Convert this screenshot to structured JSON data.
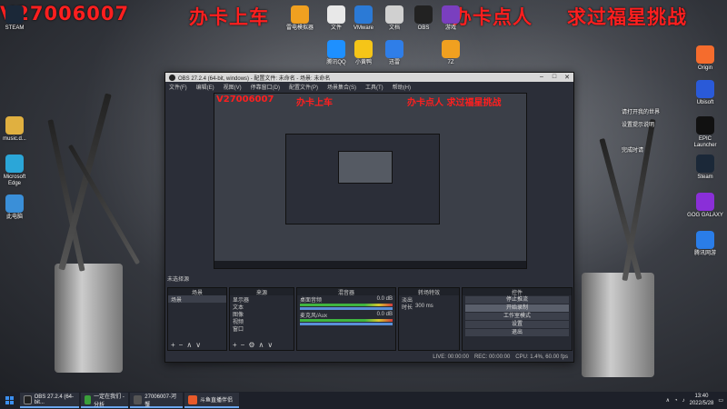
{
  "overlay": {
    "left_text": "V27006007",
    "mid_text": "办卡上车",
    "right_text_1": "办卡点人",
    "right_text_2": "求过福星挑战"
  },
  "desktop_icons_top": [
    {
      "label": "STEAM",
      "name": "steam-top-icon",
      "color": "#1b2838"
    },
    {
      "label": "雷电模拟器",
      "name": "emulator-icon",
      "color": "#f0a020"
    },
    {
      "label": "文件",
      "name": "file-icon",
      "color": "#e8e8e8"
    },
    {
      "label": "VMware",
      "name": "vmware-icon",
      "color": "#2b7ad6"
    },
    {
      "label": "文档",
      "name": "doc-icon",
      "color": "#d0d0d0"
    },
    {
      "label": "OBS",
      "name": "obs-desktop-icon",
      "color": "#222"
    },
    {
      "label": "游戏",
      "name": "game-icon",
      "color": "#7a3fbf"
    }
  ],
  "desktop_icons_row2": [
    {
      "label": "腾讯QQ",
      "name": "qq-icon",
      "color": "#1e90ff"
    },
    {
      "label": "小黄鸭",
      "name": "duck-icon",
      "color": "#f5c518"
    },
    {
      "label": "迅雷",
      "name": "thunder-icon",
      "color": "#2f7ee8"
    },
    {
      "label": "7Z",
      "name": "zip-icon",
      "color": "#f0a020"
    }
  ],
  "desktop_icons_left": [
    {
      "label": "music.d...",
      "name": "music-folder-icon",
      "color": "#e0b040"
    },
    {
      "label": "Microsoft Edge",
      "name": "edge-icon",
      "color": "#2ba6d8"
    },
    {
      "label": "此电脑",
      "name": "this-pc-icon",
      "color": "#3a8fd8"
    }
  ],
  "desktop_icons_right": [
    {
      "label": "Origin",
      "name": "origin-icon",
      "color": "#f56c2d"
    },
    {
      "label": "Ubisoft",
      "name": "ubisoft-icon",
      "color": "#2a5ad8"
    },
    {
      "label": "EPIC Launcher",
      "name": "epic-icon",
      "color": "#111"
    },
    {
      "label": "Steam",
      "name": "steam-icon",
      "color": "#1b2838"
    },
    {
      "label": "GOG GALAXY",
      "name": "gog-icon",
      "color": "#8a2fd8"
    },
    {
      "label": "腾讯网游",
      "name": "tencent-game-icon",
      "color": "#2a7de8"
    }
  ],
  "side_texts": [
    "腾讯",
    "游戏",
    "设置",
    "说明书",
    "请打开我的世界",
    "设置提示说明",
    "完成时请"
  ],
  "obs": {
    "title": "OBS 27.2.4 (64-bit, windows) - 配置文件: 未命名 - 场景: 未命名",
    "menu": [
      "文件(F)",
      "编辑(E)",
      "视图(V)",
      "停靠窗口(D)",
      "配置文件(P)",
      "场景集合(S)",
      "工具(T)",
      "帮助(H)"
    ],
    "preview_overlay_left": "V27006007",
    "preview_overlay_mid": "办卡上车",
    "preview_overlay_right": "办卡点人 求过福星挑战",
    "no_source": "未选择源",
    "scenes": {
      "title": "场景",
      "items": [
        "场景"
      ]
    },
    "sources": {
      "title": "来源",
      "items": [
        "显示器",
        "文本",
        "图像",
        "视频",
        "窗口"
      ]
    },
    "mixer": {
      "title": "混音器",
      "channels": [
        {
          "name": "桌面音频",
          "db": "0.0 dB"
        },
        {
          "name": "麦克风/Aux",
          "db": "0.0 dB"
        }
      ]
    },
    "transitions": {
      "title": "转场特效",
      "type": "淡出",
      "duration_label": "时长",
      "duration": "300 ms"
    },
    "controls": {
      "title": "控件",
      "buttons": [
        "停止推流",
        "开始录制",
        "工作室模式",
        "设置",
        "退出"
      ],
      "highlight_index": 1
    },
    "status": [
      "LIVE: 00:00:00",
      "REC: 00:00:00",
      "CPU: 1.4%, 60.00 fps"
    ]
  },
  "taskbar": {
    "items": [
      {
        "label": "OBS 27.2.4 (64-bit...",
        "color": "#222"
      },
      {
        "label": "一定在我们 - 分析",
        "color": "#3a9f3a"
      },
      {
        "label": "27006007-河蟹",
        "color": "#555"
      },
      {
        "label": "斗鱼直播伴侣",
        "color": "#e85a2a"
      }
    ],
    "time": "13:40",
    "date": "2022/5/28"
  }
}
